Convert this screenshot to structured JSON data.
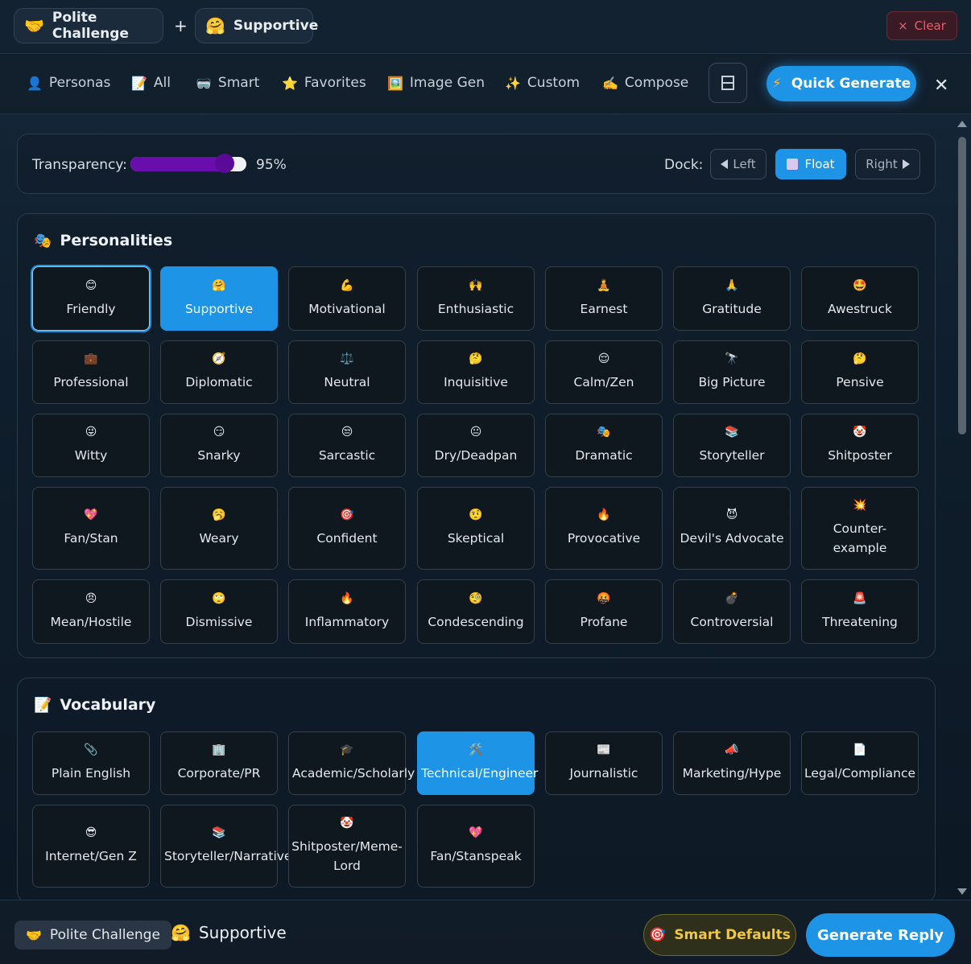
{
  "selected_chips": [
    {
      "emoji": "🤝",
      "label": "Polite Challenge"
    },
    {
      "emoji": "🤗",
      "label": "Supportive"
    }
  ],
  "plus_sign": "+",
  "clear_label": "Clear",
  "clear_icon": "×",
  "nav": [
    {
      "icon": "👤",
      "label": "Personas"
    },
    {
      "icon": "📝",
      "label": "All"
    },
    {
      "icon": "🥽",
      "label": "Smart"
    },
    {
      "icon": "⭐",
      "label": "Favorites"
    },
    {
      "icon": "🖼️",
      "label": "Image Gen"
    },
    {
      "icon": "✨",
      "label": "Custom"
    },
    {
      "icon": "✍️",
      "label": "Compose"
    }
  ],
  "quick_generate": {
    "icon": "⚡",
    "label": "Quick Generate"
  },
  "close_icon": "✕",
  "transparency": {
    "label": "Transparency:",
    "value_text": "95%",
    "value": 0.95
  },
  "dock": {
    "label": "Dock:",
    "left": "Left",
    "float": "Float",
    "right": "Right"
  },
  "personalities": {
    "icon": "🎭",
    "title": "Personalities",
    "items": [
      {
        "emoji": "😊",
        "label": "Friendly"
      },
      {
        "emoji": "🤗",
        "label": "Supportive"
      },
      {
        "emoji": "💪",
        "label": "Motivational"
      },
      {
        "emoji": "🙌",
        "label": "Enthusiastic"
      },
      {
        "emoji": "🧘",
        "label": "Earnest"
      },
      {
        "emoji": "🙏",
        "label": "Gratitude"
      },
      {
        "emoji": "🤩",
        "label": "Awestruck"
      },
      {
        "emoji": "💼",
        "label": "Professional"
      },
      {
        "emoji": "🧭",
        "label": "Diplomatic"
      },
      {
        "emoji": "⚖️",
        "label": "Neutral"
      },
      {
        "emoji": "🤔",
        "label": "Inquisitive"
      },
      {
        "emoji": "😌",
        "label": "Calm/Zen"
      },
      {
        "emoji": "🔭",
        "label": "Big Picture"
      },
      {
        "emoji": "🤔",
        "label": "Pensive"
      },
      {
        "emoji": "😜",
        "label": "Witty"
      },
      {
        "emoji": "😏",
        "label": "Snarky"
      },
      {
        "emoji": "😒",
        "label": "Sarcastic"
      },
      {
        "emoji": "😐",
        "label": "Dry/Deadpan"
      },
      {
        "emoji": "🎭",
        "label": "Dramatic"
      },
      {
        "emoji": "📚",
        "label": "Storyteller"
      },
      {
        "emoji": "🤡",
        "label": "Shitposter"
      },
      {
        "emoji": "💖",
        "label": "Fan/Stan"
      },
      {
        "emoji": "🥱",
        "label": "Weary"
      },
      {
        "emoji": "🎯",
        "label": "Confident"
      },
      {
        "emoji": "🤨",
        "label": "Skeptical"
      },
      {
        "emoji": "🔥",
        "label": "Provocative"
      },
      {
        "emoji": "😈",
        "label": "Devil's Advocate"
      },
      {
        "emoji": "💥",
        "label": "Counter-example"
      },
      {
        "emoji": "😠",
        "label": "Mean/Hostile"
      },
      {
        "emoji": "🙄",
        "label": "Dismissive"
      },
      {
        "emoji": "🔥",
        "label": "Inflammatory"
      },
      {
        "emoji": "🧐",
        "label": "Condescending"
      },
      {
        "emoji": "🤬",
        "label": "Profane"
      },
      {
        "emoji": "💣",
        "label": "Controversial"
      },
      {
        "emoji": "🚨",
        "label": "Threatening"
      }
    ]
  },
  "vocabulary": {
    "icon": "📝",
    "title": "Vocabulary",
    "items": [
      {
        "emoji": "📎",
        "label": "Plain English"
      },
      {
        "emoji": "🏢",
        "label": "Corporate/PR"
      },
      {
        "emoji": "🎓",
        "label": "Academic/Scholarly"
      },
      {
        "emoji": "🛠️",
        "label": "Technical/Engineer"
      },
      {
        "emoji": "📰",
        "label": "Journalistic"
      },
      {
        "emoji": "📣",
        "label": "Marketing/Hype"
      },
      {
        "emoji": "📄",
        "label": "Legal/Compliance"
      },
      {
        "emoji": "😎",
        "label": "Internet/Gen Z"
      },
      {
        "emoji": "📚",
        "label": "Storyteller/Narrative"
      },
      {
        "emoji": "🤡",
        "label": "Shitposter/Meme-Lord"
      },
      {
        "emoji": "💖",
        "label": "Fan/Stanspeak"
      }
    ]
  },
  "footer": {
    "chip": {
      "emoji": "🤝",
      "label": "Polite Challenge"
    },
    "current": {
      "emoji": "🤗",
      "label": "Supportive"
    },
    "smart_defaults": {
      "icon": "🎯",
      "label": "Smart Defaults"
    },
    "generate_reply": "Generate Reply"
  },
  "colors": {
    "accent": "#1d94e6",
    "slider": "#6a0dad",
    "danger": "#e5606e",
    "smart": "#f3c63c"
  }
}
